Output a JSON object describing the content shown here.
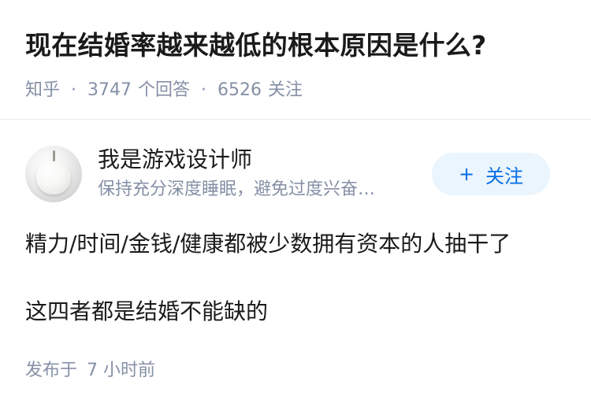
{
  "question": {
    "title": "现在结婚率越来越低的根本原因是什么?",
    "source": "知乎",
    "answer_count": "3747",
    "answer_label": "个回答",
    "follower_count": "6526",
    "follower_label": "关注"
  },
  "author": {
    "name": "我是游戏设计师",
    "bio": "保持充分深度睡眠，避免过度兴奋…",
    "follow_button_label": "关注",
    "follow_icon": "plus-icon",
    "avatar_icon": "pear-avatar-icon"
  },
  "answer": {
    "paragraphs": [
      "精力/时间/金钱/健康都被少数拥有资本的人抽干了",
      "这四者都是结婚不能缺的"
    ]
  },
  "meta": {
    "published_label": "发布于",
    "published_time": "7 小时前"
  },
  "colors": {
    "accent": "#056de8",
    "button_bg": "#ebf5fd",
    "secondary_text": "#8590a6",
    "primary_text": "#1a1a1a"
  }
}
